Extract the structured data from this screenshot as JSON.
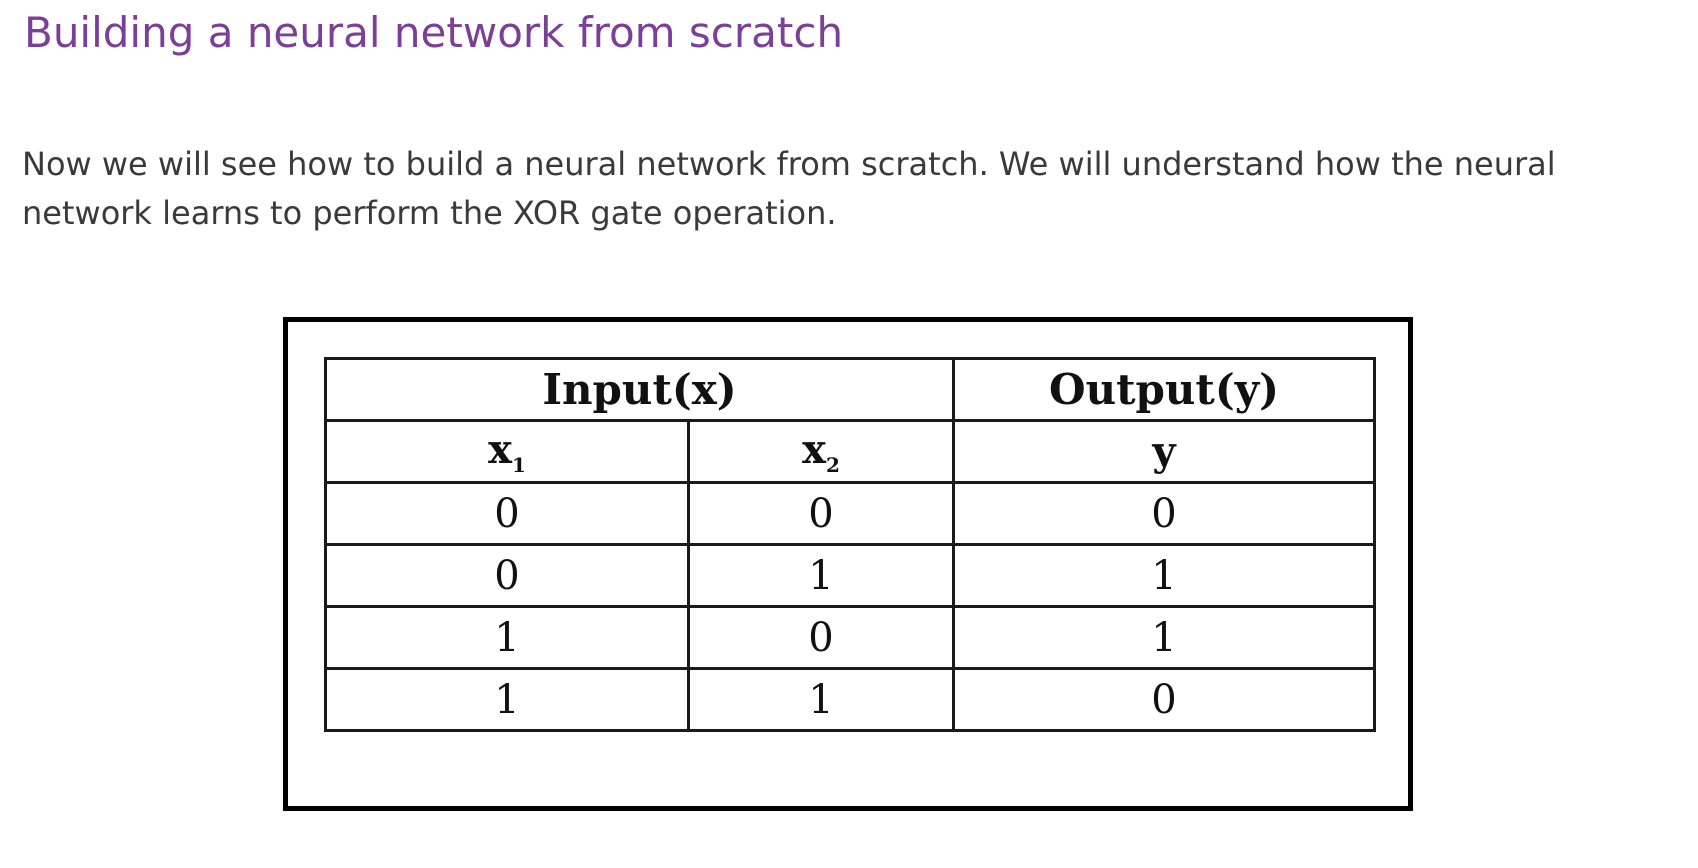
{
  "page": {
    "title": "Building a neural network from scratch",
    "paragraph": "Now we will see how to build a neural network from scratch. We will understand how the neural network learns to perform the XOR gate operation."
  },
  "colors": {
    "title": "#7b3f98",
    "body_text": "#3a3a3a",
    "border": "#000000"
  },
  "table": {
    "group_headers": {
      "input": "Input(x)",
      "output": "Output(y)"
    },
    "columns": [
      {
        "base": "x",
        "sub": "1"
      },
      {
        "base": "x",
        "sub": "2"
      },
      {
        "base": "y",
        "sub": ""
      }
    ],
    "rows": [
      [
        "0",
        "0",
        "0"
      ],
      [
        "0",
        "1",
        "1"
      ],
      [
        "1",
        "0",
        "1"
      ],
      [
        "1",
        "1",
        "0"
      ]
    ]
  }
}
